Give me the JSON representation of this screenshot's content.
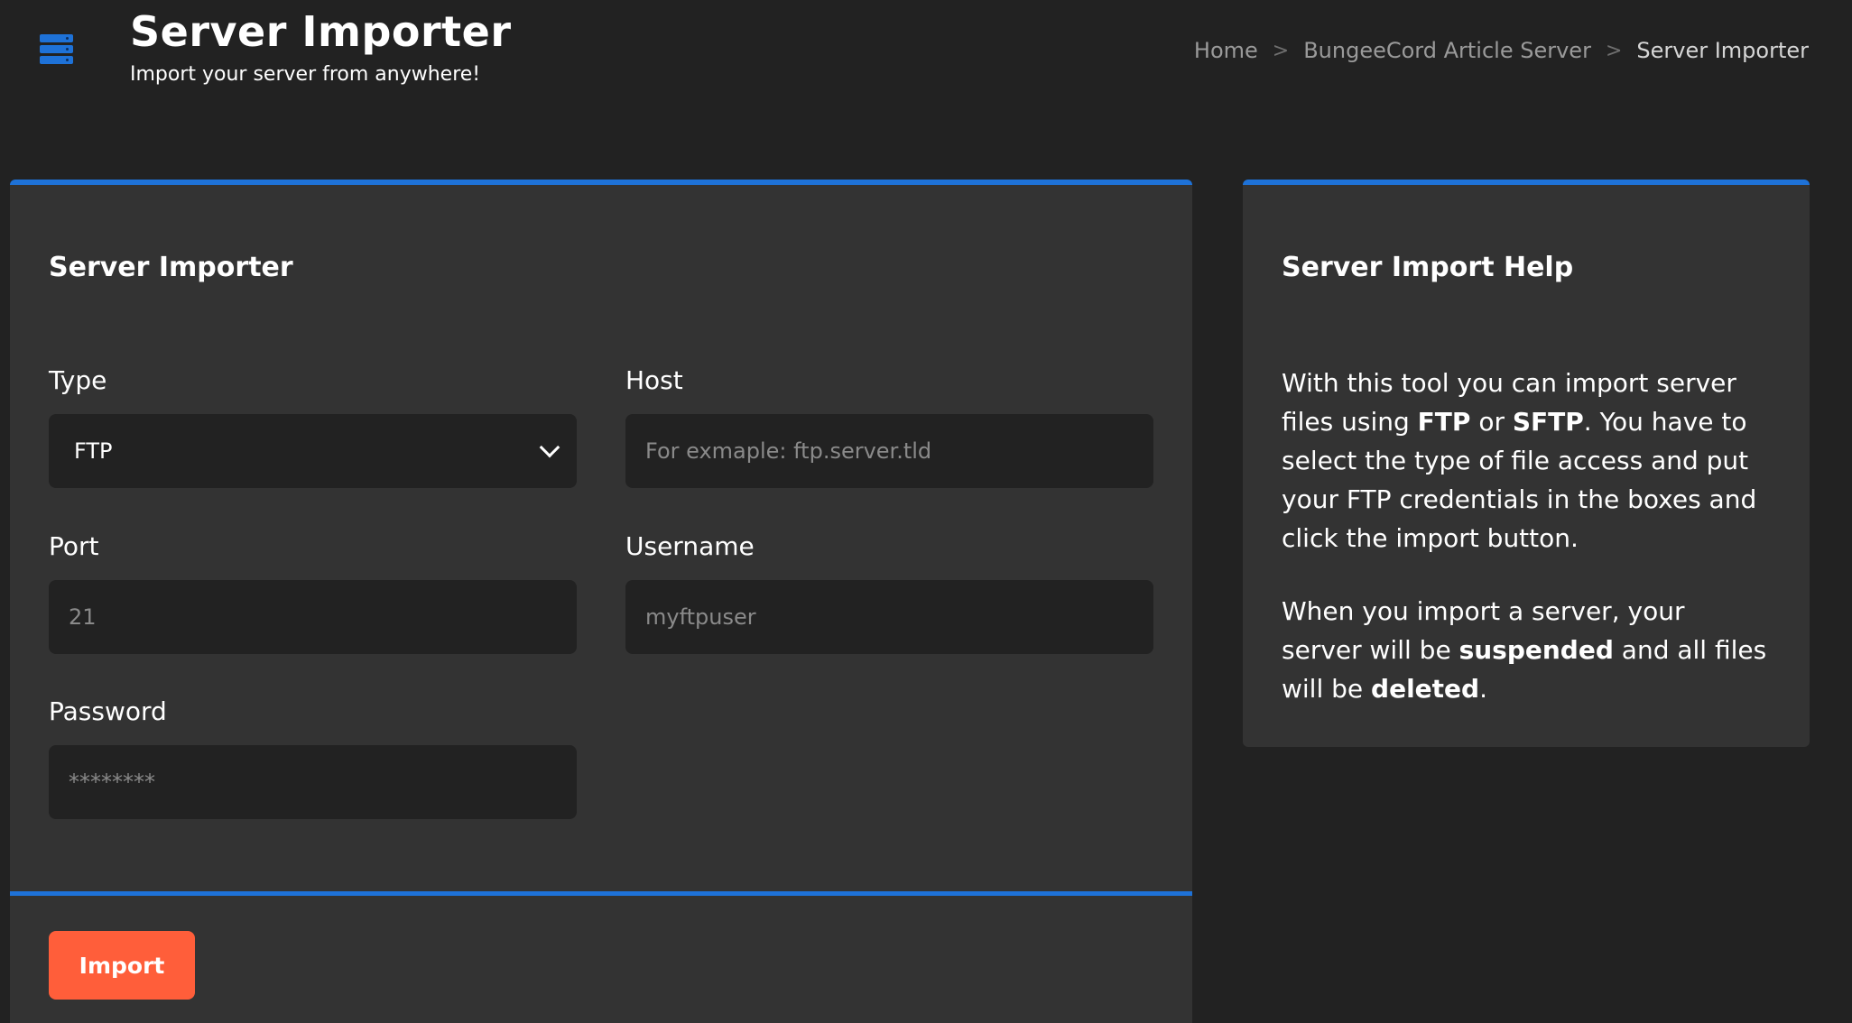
{
  "header": {
    "icon": "server-icon",
    "title": "Server Importer",
    "subtitle": "Import your server from anywhere!"
  },
  "breadcrumb": {
    "items": [
      "Home",
      "BungeeCord Article Server",
      "Server Importer"
    ],
    "separator": ">"
  },
  "importer": {
    "title": "Server Importer",
    "type_label": "Type",
    "type_value": "FTP",
    "host_label": "Host",
    "host_placeholder": "For exmaple: ftp.server.tld",
    "port_label": "Port",
    "port_placeholder": "21",
    "username_label": "Username",
    "username_placeholder": "myftpuser",
    "password_label": "Password",
    "password_placeholder": "********",
    "import_label": "Import"
  },
  "help": {
    "title": "Server Import Help",
    "p1_a": "With this tool you can import server files using ",
    "p1_b": "FTP",
    "p1_c": " or ",
    "p1_d": "SFTP",
    "p1_e": ". You have to select the type of file access and put your FTP credentials in the boxes and click the import button.",
    "p2_a": "When you import a server, your server will be ",
    "p2_b": "suspended",
    "p2_c": " and all files will be ",
    "p2_d": "deleted",
    "p2_e": "."
  },
  "colors": {
    "accent": "#1e72d8",
    "button": "#ff5e3a",
    "background": "#222222",
    "card": "#333333"
  }
}
